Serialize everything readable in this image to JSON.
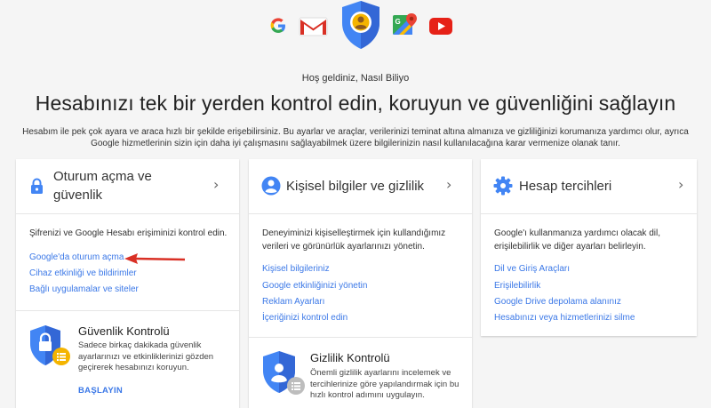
{
  "apps": [
    {
      "name": "google-logo",
      "letter": "G"
    },
    {
      "name": "gmail-logo",
      "letter": "M"
    },
    {
      "name": "account-avatar",
      "letter": "?"
    },
    {
      "name": "maps-logo",
      "letter": "G"
    },
    {
      "name": "youtube-logo",
      "letter": "▶"
    }
  ],
  "header": {
    "welcome": "Hoş geldiniz, Nasıl Biliyo",
    "title": "Hesabınızı tek bir yerden kontrol edin, koruyun ve güvenliğini sağlayın",
    "intro": "Hesabım ile pek çok ayara ve araca hızlı bir şekilde erişebilirsiniz. Bu ayarlar ve araçlar, verilerinizi teminat altına almanıza ve gizliliğinizi korumanıza yardımcı olur, ayrıca Google hizmetlerinin sizin için daha iyi çalışmasını sağlayabilmek üzere bilgilerinizin nasıl kullanılacağına karar vermenize olanak tanır."
  },
  "cards": {
    "security": {
      "title": "Oturum açma ve güvenlik",
      "icon": "lock-icon",
      "description": "Şifrenizi ve Google Hesabı erişiminizi kontrol edin.",
      "links": [
        "Google'da oturum açma",
        "Cihaz etkinliği ve bildirimler",
        "Bağlı uygulamalar ve siteler"
      ],
      "checkup": {
        "title": "Güvenlik Kontrolü",
        "description": "Sadece birkaç dakikada güvenlik ayarlarınızı ve etkinliklerinizi gözden geçirerek hesabınızı koruyun.",
        "cta": "BAŞLAYIN"
      }
    },
    "privacy": {
      "title": "Kişisel bilgiler ve gizlilik",
      "icon": "person-icon",
      "description": "Deneyiminizi kişiselleştirmek için kullandığımız verileri ve görünürlük ayarlarınızı yönetin.",
      "links": [
        "Kişisel bilgileriniz",
        "Google etkinliğinizi yönetin",
        "Reklam Ayarları",
        "İçeriğinizi kontrol edin"
      ],
      "checkup": {
        "title": "Gizlilik Kontrolü",
        "description": "Önemli gizlilik ayarlarını incelemek ve tercihlerinize göre yapılandırmak için bu hızlı kontrol adımını uygulayın."
      }
    },
    "preferences": {
      "title": "Hesap tercihleri",
      "icon": "gear-icon",
      "description": "Google'ı kullanmanıza yardımcı olacak dil, erişilebilirlik ve diğer ayarları belirleyin.",
      "links": [
        "Dil ve Giriş Araçları",
        "Erişilebilirlik",
        "Google Drive depolama alanınız",
        "Hesabınızı veya hizmetlerinizi silme"
      ]
    }
  },
  "colors": {
    "accent": "#3b78e7",
    "shield": "#4285f4",
    "arrow": "#d93025",
    "badge_yellow": "#f4b400"
  }
}
